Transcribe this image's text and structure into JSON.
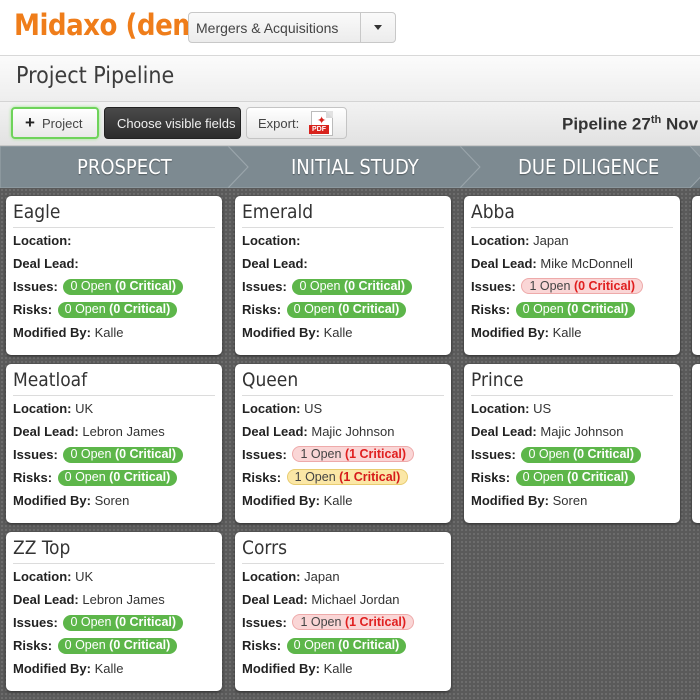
{
  "app": {
    "title": "Midaxo (demo)"
  },
  "workspace_select": {
    "value": "Mergers & Acquisitions"
  },
  "page": {
    "title": "Project Pipeline"
  },
  "toolbar": {
    "add_project_label": "Project",
    "visible_fields_label": "Choose visible fields",
    "export_label": "Export:",
    "pipeline_date_prefix": "Pipeline 27",
    "pipeline_date_suffix_sup": "th",
    "pipeline_date_rest": " Nov"
  },
  "icons": {
    "add": "plus-icon",
    "pdf": "pdf-file-icon",
    "dropdown": "caret-down-icon"
  },
  "labels": {
    "location": "Location:",
    "deal_lead": "Deal Lead:",
    "issues": "Issues:",
    "risks": "Risks:",
    "modified_by": "Modified By:",
    "pdf_mark": "✦",
    "pdf_tag": "PDF"
  },
  "colors": {
    "brand": "#ef7d1a",
    "ok_badge": "#5db64a",
    "critical": "#e02020",
    "warning_badge": "#fbe7a6"
  },
  "stages": [
    {
      "label": "PROSPECT",
      "cards": [
        {
          "title": "Eagle",
          "location": "",
          "deal_lead": "",
          "issues": {
            "open": "0 Open",
            "critical": "(0 Critical)",
            "status": "green"
          },
          "risks": {
            "open": "0 Open",
            "critical": "(0 Critical)",
            "status": "green"
          },
          "modified_by": "Kalle"
        },
        {
          "title": "Meatloaf",
          "location": "UK",
          "deal_lead": "Lebron James",
          "issues": {
            "open": "0 Open",
            "critical": "(0 Critical)",
            "status": "green"
          },
          "risks": {
            "open": "0 Open",
            "critical": "(0 Critical)",
            "status": "green"
          },
          "modified_by": "Soren"
        },
        {
          "title": "ZZ Top",
          "location": "UK",
          "deal_lead": "Lebron James",
          "issues": {
            "open": "0 Open",
            "critical": "(0 Critical)",
            "status": "green"
          },
          "risks": {
            "open": "0 Open",
            "critical": "(0 Critical)",
            "status": "green"
          },
          "modified_by": "Kalle"
        }
      ]
    },
    {
      "label": "INITIAL STUDY",
      "cards": [
        {
          "title": "Emerald",
          "location": "",
          "deal_lead": "",
          "issues": {
            "open": "0 Open",
            "critical": "(0 Critical)",
            "status": "green"
          },
          "risks": {
            "open": "0 Open",
            "critical": "(0 Critical)",
            "status": "green"
          },
          "modified_by": "Kalle"
        },
        {
          "title": "Queen",
          "location": "US",
          "deal_lead": "Majic Johnson",
          "issues": {
            "open": "1 Open",
            "critical": "(1 Critical)",
            "status": "red"
          },
          "risks": {
            "open": "1 Open",
            "critical": "(1 Critical)",
            "status": "yellow"
          },
          "modified_by": "Kalle"
        },
        {
          "title": "Corrs",
          "location": "Japan",
          "deal_lead": "Michael Jordan",
          "issues": {
            "open": "1 Open",
            "critical": "(1 Critical)",
            "status": "red"
          },
          "risks": {
            "open": "0 Open",
            "critical": "(0 Critical)",
            "status": "green"
          },
          "modified_by": "Kalle"
        }
      ]
    },
    {
      "label": "DUE DILIGENCE",
      "cards": [
        {
          "title": "Abba",
          "location": "Japan",
          "deal_lead": "Mike McDonnell",
          "issues": {
            "open": "1 Open",
            "critical": "(0 Critical)",
            "status": "red"
          },
          "risks": {
            "open": "0 Open",
            "critical": "(0 Critical)",
            "status": "green"
          },
          "modified_by": "Kalle"
        },
        {
          "title": "Prince",
          "location": "US",
          "deal_lead": "Majic Johnson",
          "issues": {
            "open": "0 Open",
            "critical": "(0 Critical)",
            "status": "green"
          },
          "risks": {
            "open": "0 Open",
            "critical": "(0 Critical)",
            "status": "green"
          },
          "modified_by": "Soren"
        }
      ]
    }
  ]
}
